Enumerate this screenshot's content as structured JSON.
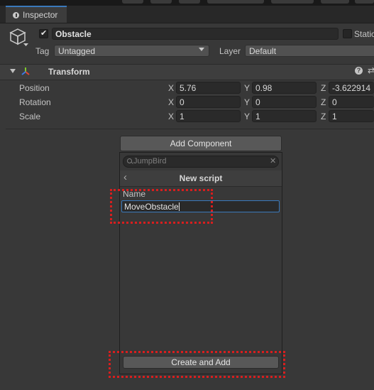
{
  "window": {
    "tab_label": "Inspector"
  },
  "header": {
    "object_name": "Obstacle",
    "static_label": "Static",
    "tag_label": "Tag",
    "tag_value": "Untagged",
    "layer_label": "Layer",
    "layer_value": "Default"
  },
  "transform": {
    "title": "Transform",
    "rows": [
      {
        "label": "Position",
        "x": "5.76",
        "y": "0.98",
        "z": "-3.622914"
      },
      {
        "label": "Rotation",
        "x": "0",
        "y": "0",
        "z": "0"
      },
      {
        "label": "Scale",
        "x": "1",
        "y": "1",
        "z": "1"
      }
    ],
    "axis_labels": {
      "x": "X",
      "y": "Y",
      "z": "Z"
    }
  },
  "add_component": {
    "button_label": "Add Component",
    "search_placeholder": "JumpBird",
    "subheader_title": "New script",
    "name_label": "Name",
    "name_value": "MoveObstacle",
    "create_button_label": "Create and Add"
  },
  "colors": {
    "background": "#383838",
    "accent": "#3a79bb",
    "highlight": "#d81e1e"
  },
  "icons": [
    "inspector-icon",
    "gameobject-cube-icon",
    "checkmark-icon",
    "transform-icon",
    "help-icon",
    "settings-icon",
    "search-icon",
    "clear-icon",
    "back-icon"
  ]
}
